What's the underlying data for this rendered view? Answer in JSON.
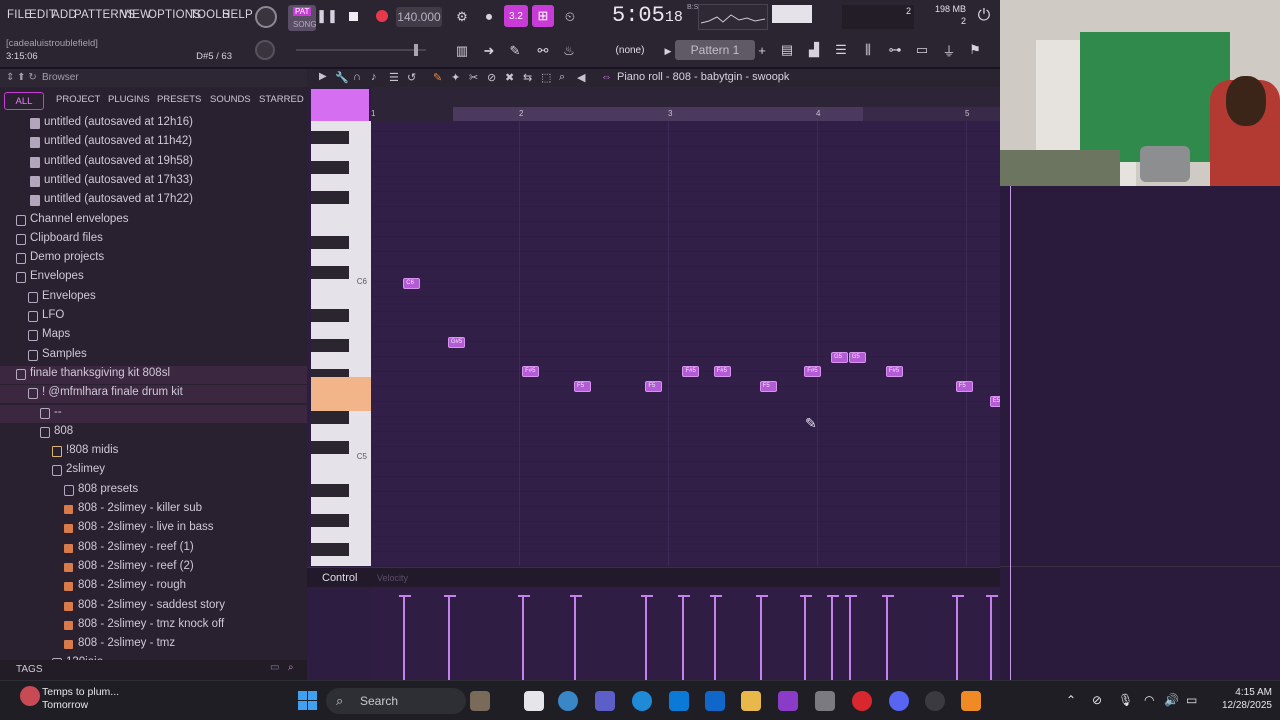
{
  "menu": [
    "FILE",
    "EDIT",
    "ADD",
    "PATTERNS",
    "VIEW",
    "OPTIONS",
    "TOOLS",
    "HELP"
  ],
  "transport": {
    "pat_label": "PAT",
    "song_label": "SONG",
    "tempo": "140.000",
    "time": "5:05",
    "time_sub": "18",
    "time_unit": "B:ST",
    "memory": "198 MB",
    "cpu": "2",
    "poly": "2",
    "ratio": "3.2"
  },
  "hint": {
    "project": "[cadealuistroublefield]",
    "duration": "3:15:06",
    "note": "D#5 / 63"
  },
  "toolbar": {
    "none_label": "(none)",
    "pattern": "Pattern 1",
    "add": "+"
  },
  "browser": {
    "title": "Browser",
    "tabs": [
      "ALL",
      "PROJECT",
      "PLUGINS",
      "PRESETS",
      "SOUNDS",
      "STARRED"
    ],
    "items": [
      {
        "label": "untitled (autosaved at 12h16)",
        "type": "file",
        "indent": 30
      },
      {
        "label": "untitled (autosaved at 11h42)",
        "type": "file",
        "indent": 30
      },
      {
        "label": "untitled (autosaved at 19h58)",
        "type": "file",
        "indent": 30
      },
      {
        "label": "untitled (autosaved at 17h33)",
        "type": "file",
        "indent": 30
      },
      {
        "label": "untitled (autosaved at 17h22)",
        "type": "file",
        "indent": 30
      },
      {
        "label": "Channel envelopes",
        "type": "folder",
        "indent": 16
      },
      {
        "label": "Clipboard files",
        "type": "folder",
        "indent": 16
      },
      {
        "label": "Demo projects",
        "type": "folder",
        "indent": 16
      },
      {
        "label": "Envelopes",
        "type": "folder",
        "indent": 16
      },
      {
        "label": "Envelopes",
        "type": "folder",
        "indent": 28
      },
      {
        "label": "LFO",
        "type": "folder",
        "indent": 28
      },
      {
        "label": "Maps",
        "type": "folder",
        "indent": 28
      },
      {
        "label": "Samples",
        "type": "folder",
        "indent": 28
      },
      {
        "label": "finale thanksgiving kit 808sl",
        "type": "folder",
        "indent": 16
      },
      {
        "label": "!  @mfmlhara finale drum kit",
        "type": "folder",
        "indent": 28
      },
      {
        "label": "--",
        "type": "folder",
        "indent": 40
      },
      {
        "label": "808",
        "type": "folder",
        "indent": 40
      },
      {
        "label": "!808 midis",
        "type": "midi",
        "indent": 52
      },
      {
        "label": "2slimey",
        "type": "folder",
        "indent": 52
      },
      {
        "label": "808 presets",
        "type": "folder",
        "indent": 64
      },
      {
        "label": "808 - 2slimey - killer sub",
        "type": "preset",
        "indent": 64
      },
      {
        "label": "808 - 2slimey - live in bass",
        "type": "preset",
        "indent": 64
      },
      {
        "label": "808 - 2slimey - reef (1)",
        "type": "preset",
        "indent": 64
      },
      {
        "label": "808 - 2slimey - reef (2)",
        "type": "preset",
        "indent": 64
      },
      {
        "label": "808 - 2slimey - rough",
        "type": "preset",
        "indent": 64
      },
      {
        "label": "808 - 2slimey - saddest story",
        "type": "preset",
        "indent": 64
      },
      {
        "label": "808 - 2slimey - tmz knock off",
        "type": "preset",
        "indent": 64
      },
      {
        "label": "808 - 2slimey - tmz",
        "type": "preset",
        "indent": 64
      },
      {
        "label": "130jajo",
        "type": "folder",
        "indent": 52
      }
    ],
    "tags": "TAGS"
  },
  "pianoroll": {
    "title": "Piano roll - 808 - babytgin - swoopk",
    "bars": [
      "1",
      "2",
      "3",
      "4",
      "5"
    ],
    "key_labels": [
      "C6",
      "C5"
    ],
    "notes": [
      {
        "label": "C6",
        "bar": 1.15,
        "row": "C6"
      },
      {
        "label": "G#5",
        "bar": 1.45,
        "row": "G#5"
      },
      {
        "label": "F#5",
        "bar": 1.95,
        "row": "F#5"
      },
      {
        "label": "F5",
        "bar": 2.3,
        "row": "F5"
      },
      {
        "label": "F5",
        "bar": 2.78,
        "row": "F5"
      },
      {
        "label": "F#5",
        "bar": 3.03,
        "row": "F#5"
      },
      {
        "label": "F#5",
        "bar": 3.24,
        "row": "F#5"
      },
      {
        "label": "F5",
        "bar": 3.55,
        "row": "F5"
      },
      {
        "label": "F#5",
        "bar": 3.85,
        "row": "F#5"
      },
      {
        "label": "G5",
        "bar": 4.03,
        "row": "G5"
      },
      {
        "label": "G5",
        "bar": 4.15,
        "row": "G5"
      },
      {
        "label": "F#5",
        "bar": 4.4,
        "row": "F#5"
      },
      {
        "label": "F5",
        "bar": 4.87,
        "row": "F5"
      },
      {
        "label": "E5",
        "bar": 5.1,
        "row": "E5"
      }
    ],
    "control_label": "Control",
    "velocity_label": "Velocity"
  },
  "taskbar": {
    "search": "Search",
    "weather_line1": "Temps to plum...",
    "weather_line2": "Tomorrow",
    "time": "4:15 AM",
    "date": "12/28/2025"
  },
  "colors": {
    "accent": "#c83bd6",
    "note": "#b45bd6",
    "grid": "#2e1c44",
    "highlight": "#f2b58a"
  }
}
